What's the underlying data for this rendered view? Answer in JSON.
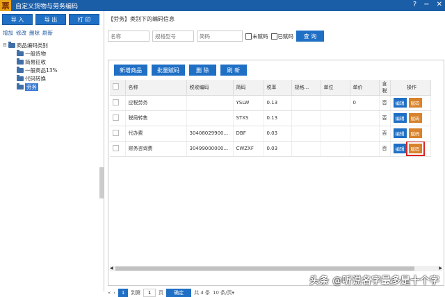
{
  "window": {
    "logo": "票",
    "title": "自定义货物与劳务编码",
    "help": "?",
    "minimize": "−",
    "close": "✕"
  },
  "left": {
    "buttons": [
      "导 入",
      "导 出",
      "打 印"
    ],
    "actions": [
      "增加",
      "修改",
      "删除",
      "刷新"
    ],
    "tree": {
      "root": "商品编码类别",
      "children": [
        "一般货物",
        "简易征收",
        "一般商品13%",
        "代码转换",
        "劳务"
      ]
    }
  },
  "right": {
    "header": "【劳务】类别下的编码信息",
    "search": {
      "name_placeholder": "名称",
      "model_placeholder": "规格型号",
      "short_placeholder": "简码",
      "unassigned": "未赋码",
      "assigned": "已赋码",
      "query": "查 询"
    },
    "actions": [
      "新增商品",
      "批量赋码",
      "删 除",
      "刷 新"
    ],
    "columns": [
      "名称",
      "税收编码",
      "简码",
      "税率",
      "规格...",
      "单位",
      "单价",
      "含税",
      "操作"
    ],
    "rows": [
      {
        "name": "应税劳务",
        "code": "",
        "short": "YSLW",
        "rate": "0.13",
        "spec": "",
        "unit": "",
        "price": "0",
        "tax": "否",
        "edit": "编辑",
        "assign": "赋码"
      },
      {
        "name": "税局转售",
        "code": "",
        "short": "STXS",
        "rate": "0.13",
        "spec": "",
        "unit": "",
        "price": "",
        "tax": "否",
        "edit": "编辑",
        "assign": "赋码"
      },
      {
        "name": "代办费",
        "code": "30408029900...",
        "short": "DBF",
        "rate": "0.03",
        "spec": "",
        "unit": "",
        "price": "",
        "tax": "否",
        "edit": "编辑",
        "assign": "赋码"
      },
      {
        "name": "财务咨询费",
        "code": "30499000000...",
        "short": "CWZXF",
        "rate": "0.03",
        "spec": "",
        "unit": "",
        "price": "",
        "tax": "否",
        "edit": "编辑",
        "assign": "赋码"
      }
    ],
    "pager": {
      "first": "«",
      "prev": "‹",
      "page": "1",
      "goto_label": "到第",
      "goto_value": "1",
      "page_unit": "页",
      "ok": "确定",
      "total": "共 4 条",
      "size": "10 条/页",
      "size_arrow": "▾"
    }
  },
  "watermark": "头条 @听说名字最多是十个字"
}
